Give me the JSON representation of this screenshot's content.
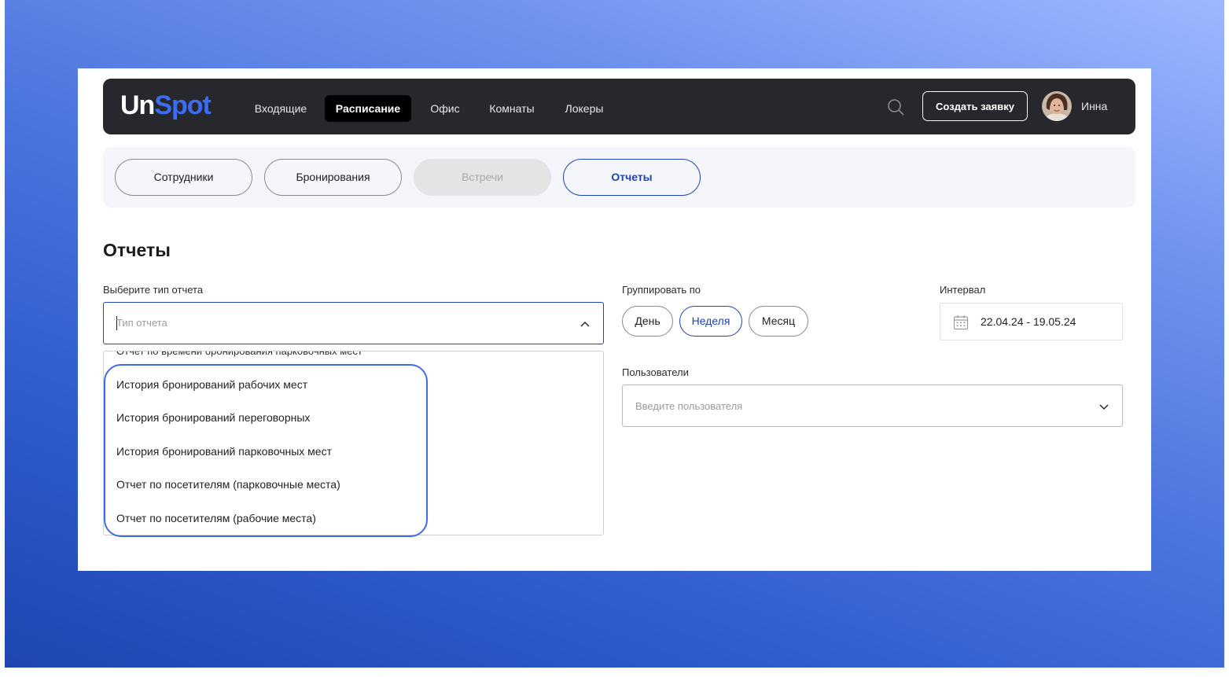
{
  "header": {
    "logo_part1": "Un",
    "logo_part2": "Spot",
    "nav": [
      {
        "label": "Входящие",
        "active": false
      },
      {
        "label": "Расписание",
        "active": true
      },
      {
        "label": "Офис",
        "active": false
      },
      {
        "label": "Комнаты",
        "active": false
      },
      {
        "label": "Локеры",
        "active": false
      }
    ],
    "search_icon": "search-icon",
    "create_button": "Создать заявку",
    "user_name": "Инна"
  },
  "subnav": {
    "tabs": [
      {
        "label": "Сотрудники",
        "state": "default"
      },
      {
        "label": "Бронирования",
        "state": "default"
      },
      {
        "label": "Встречи",
        "state": "disabled"
      },
      {
        "label": "Отчеты",
        "state": "active"
      }
    ]
  },
  "page": {
    "title": "Отчеты",
    "report_type": {
      "label": "Выберите тип отчета",
      "placeholder": "Тип отчета",
      "options_partial_top": "Отчет по времени бронирования парковочных мест",
      "options": [
        "История бронирований рабочих мест",
        "История бронирований переговорных",
        "История бронирований парковочных мест",
        "Отчет по посетителям (парковочные места)",
        "Отчет по посетителям (рабочие места)"
      ]
    },
    "group_by": {
      "label": "Группировать по",
      "options": [
        "День",
        "Неделя",
        "Месяц"
      ],
      "selected": "Неделя"
    },
    "interval": {
      "label": "Интервал",
      "value": "22.04.24 - 19.05.24"
    },
    "users": {
      "label": "Пользователи",
      "placeholder": "Введите пользователя"
    }
  },
  "colors": {
    "accent": "#1d44b8",
    "logo_blue": "#3d6cf0",
    "topbar": "#26282d",
    "highlight": "#3d6ce6"
  }
}
